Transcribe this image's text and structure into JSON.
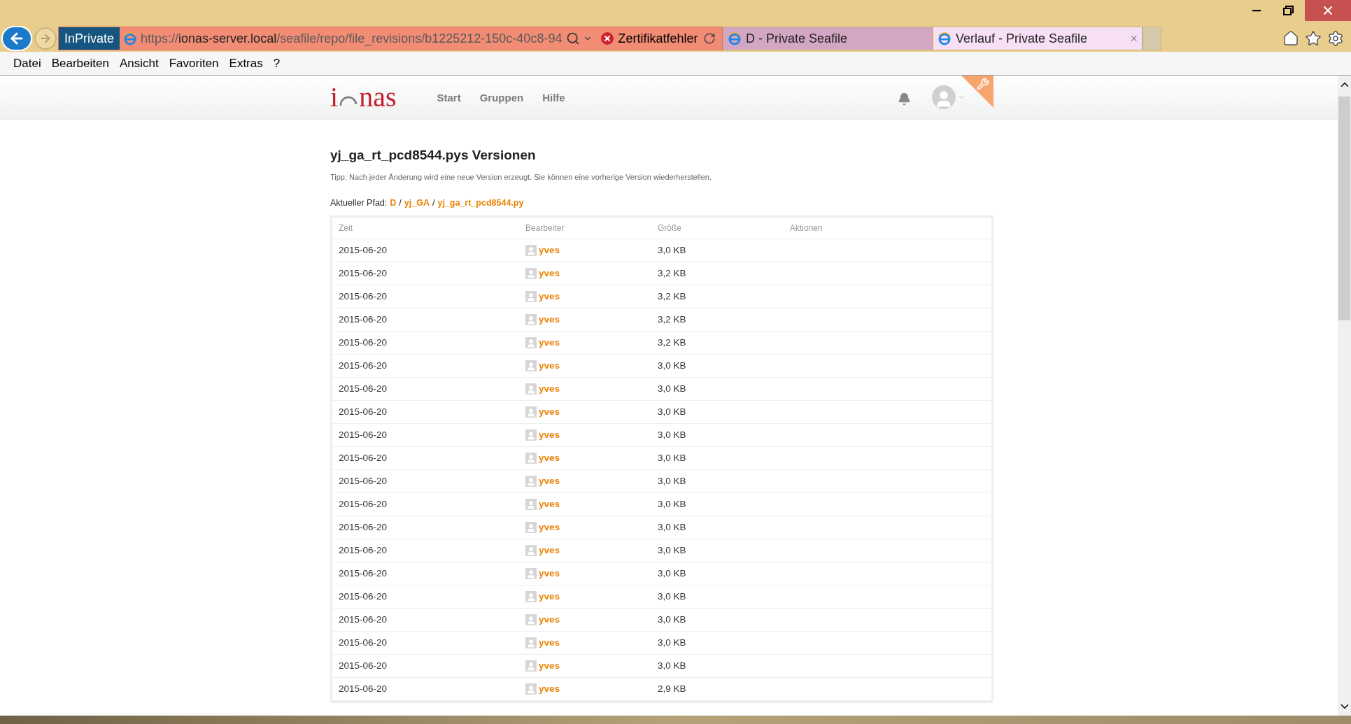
{
  "address_bar": {
    "badge": "InPrivate",
    "scheme": "https://",
    "host": "ionas-server.local",
    "path": "/seafile/repo/file_revisions/b1225212-150c-40c8-94",
    "cert_error": "Zertifikatfehler"
  },
  "tabs": [
    {
      "title": "D - Private Seafile",
      "selected": false
    },
    {
      "title": "Verlauf - Private Seafile",
      "selected": true,
      "close": "×"
    }
  ],
  "menu": [
    "Datei",
    "Bearbeiten",
    "Ansicht",
    "Favoriten",
    "Extras",
    "?"
  ],
  "site": {
    "logo_left": "i",
    "logo_right": "nas",
    "nav": [
      "Start",
      "Gruppen",
      "Hilfe"
    ]
  },
  "page": {
    "title": "yj_ga_rt_pcd8544.pys Versionen",
    "tip": "Tipp: Nach jeder Änderung wird eine neue Version erzeugt. Sie können eine vorherige Version wiederherstellen.",
    "path_label": "Aktueller Pfad:",
    "path": [
      "D",
      "yj_GA",
      "yj_ga_rt_pcd8544.py"
    ],
    "separator": "/"
  },
  "table": {
    "columns": [
      "Zeit",
      "Bearbeiter",
      "Größe",
      "Aktionen"
    ],
    "rows": [
      {
        "time": "2015-06-20",
        "editor": "yves",
        "size": "3,0 KB"
      },
      {
        "time": "2015-06-20",
        "editor": "yves",
        "size": "3,2 KB"
      },
      {
        "time": "2015-06-20",
        "editor": "yves",
        "size": "3,2 KB"
      },
      {
        "time": "2015-06-20",
        "editor": "yves",
        "size": "3,2 KB"
      },
      {
        "time": "2015-06-20",
        "editor": "yves",
        "size": "3,2 KB"
      },
      {
        "time": "2015-06-20",
        "editor": "yves",
        "size": "3,0 KB"
      },
      {
        "time": "2015-06-20",
        "editor": "yves",
        "size": "3,0 KB"
      },
      {
        "time": "2015-06-20",
        "editor": "yves",
        "size": "3,0 KB"
      },
      {
        "time": "2015-06-20",
        "editor": "yves",
        "size": "3,0 KB"
      },
      {
        "time": "2015-06-20",
        "editor": "yves",
        "size": "3,0 KB"
      },
      {
        "time": "2015-06-20",
        "editor": "yves",
        "size": "3,0 KB"
      },
      {
        "time": "2015-06-20",
        "editor": "yves",
        "size": "3,0 KB"
      },
      {
        "time": "2015-06-20",
        "editor": "yves",
        "size": "3,0 KB"
      },
      {
        "time": "2015-06-20",
        "editor": "yves",
        "size": "3,0 KB"
      },
      {
        "time": "2015-06-20",
        "editor": "yves",
        "size": "3,0 KB"
      },
      {
        "time": "2015-06-20",
        "editor": "yves",
        "size": "3,0 KB"
      },
      {
        "time": "2015-06-20",
        "editor": "yves",
        "size": "3,0 KB"
      },
      {
        "time": "2015-06-20",
        "editor": "yves",
        "size": "3,0 KB"
      },
      {
        "time": "2015-06-20",
        "editor": "yves",
        "size": "3,0 KB"
      },
      {
        "time": "2015-06-20",
        "editor": "yves",
        "size": "2,9 KB"
      }
    ]
  }
}
